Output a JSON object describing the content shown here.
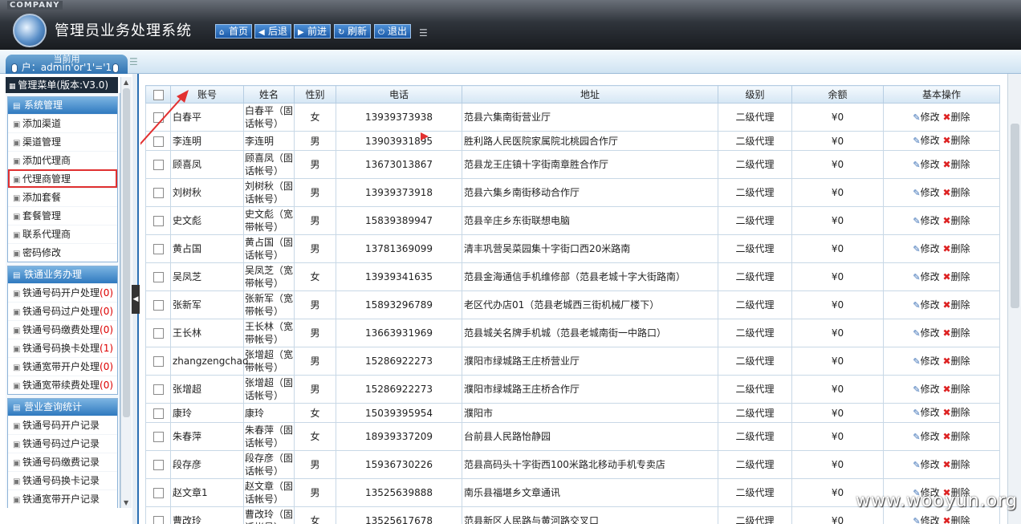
{
  "header": {
    "company": "COMPANY",
    "title": "管理员业务处理系统",
    "nav": [
      {
        "label": "首页",
        "icon": "home-icon"
      },
      {
        "label": "后退",
        "icon": "back-arrow-icon"
      },
      {
        "label": "前进",
        "icon": "forward-arrow-icon"
      },
      {
        "label": "刷新",
        "icon": "refresh-icon"
      },
      {
        "label": "退出",
        "icon": "power-icon"
      }
    ]
  },
  "user_tab": {
    "line1": "当前用",
    "line2": "户：admin'or'1'='1"
  },
  "sidebar": {
    "menu_title": "管理菜单(版本:V3.0)",
    "groups": [
      {
        "title": "系统管理",
        "items": [
          {
            "label": "添加渠道"
          },
          {
            "label": "渠道管理"
          },
          {
            "label": "添加代理商"
          },
          {
            "label": "代理商管理"
          },
          {
            "label": "添加套餐"
          },
          {
            "label": "套餐管理"
          },
          {
            "label": "联系代理商"
          },
          {
            "label": "密码修改"
          }
        ]
      },
      {
        "title": "铁通业务办理",
        "items": [
          {
            "label": "铁通号码开户处理",
            "count": "(0)"
          },
          {
            "label": "铁通号码过户处理",
            "count": "(0)"
          },
          {
            "label": "铁通号码缴费处理",
            "count": "(0)"
          },
          {
            "label": "铁通号码换卡处理",
            "count": "(1)"
          },
          {
            "label": "铁通宽带开户处理",
            "count": "(0)"
          },
          {
            "label": "铁通宽带续费处理",
            "count": "(0)"
          }
        ]
      },
      {
        "title": "营业查询统计",
        "items": [
          {
            "label": "铁通号码开户记录"
          },
          {
            "label": "铁通号码过户记录"
          },
          {
            "label": "铁通号码缴费记录"
          },
          {
            "label": "铁通号码换卡记录"
          },
          {
            "label": "铁通宽带开户记录"
          }
        ]
      }
    ]
  },
  "table": {
    "headers": [
      "账号",
      "姓名",
      "性别",
      "电话",
      "地址",
      "级别",
      "余额",
      "基本操作"
    ],
    "edit_label": "修改",
    "delete_label": "删除",
    "rows": [
      {
        "account": "白春平",
        "name": "白春平（固话帐号）",
        "gender": "女",
        "phone": "13939373938",
        "address": "范县六集南街营业厅",
        "level": "二级代理",
        "balance": "¥0"
      },
      {
        "account": "李连明",
        "name": "李连明",
        "gender": "男",
        "phone": "13903931895",
        "address": "胜利路人民医院家属院北桃园合作厅",
        "level": "二级代理",
        "balance": "¥0"
      },
      {
        "account": "顾喜凤",
        "name": "顾喜凤（固话帐号）",
        "gender": "男",
        "phone": "13673013867",
        "address": "范县龙王庄镇十字街南章胜合作厅",
        "level": "二级代理",
        "balance": "¥0"
      },
      {
        "account": "刘树秋",
        "name": "刘树秋（固话帐号）",
        "gender": "男",
        "phone": "13939373918",
        "address": "范县六集乡南街移动合作厅",
        "level": "二级代理",
        "balance": "¥0"
      },
      {
        "account": "史文彪",
        "name": "史文彪（宽带帐号）",
        "gender": "男",
        "phone": "15839389947",
        "address": "范县辛庄乡东街联想电脑",
        "level": "二级代理",
        "balance": "¥0"
      },
      {
        "account": "黄占国",
        "name": "黄占国（固话帐号）",
        "gender": "男",
        "phone": "13781369099",
        "address": "清丰巩营吴菜园集十字街口西20米路南",
        "level": "二级代理",
        "balance": "¥0"
      },
      {
        "account": "吴凤芝",
        "name": "吴凤芝（宽带帐号）",
        "gender": "女",
        "phone": "13939341635",
        "address": "范县金海通信手机维修部（范县老城十字大街路南）",
        "level": "二级代理",
        "balance": "¥0"
      },
      {
        "account": "张新军",
        "name": "张新军（宽带帐号）",
        "gender": "男",
        "phone": "15893296789",
        "address": "老区代办店01（范县老城西三街机械厂楼下）",
        "level": "二级代理",
        "balance": "¥0"
      },
      {
        "account": "王长林",
        "name": "王长林（宽带帐号）",
        "gender": "男",
        "phone": "13663931969",
        "address": "范县城关名牌手机城（范县老城南街一中路口）",
        "level": "二级代理",
        "balance": "¥0"
      },
      {
        "account": "zhangzengchao",
        "name": "张增超（宽带帐号）",
        "gender": "男",
        "phone": "15286922273",
        "address": "濮阳市绿城路王庄桥营业厅",
        "level": "二级代理",
        "balance": "¥0"
      },
      {
        "account": "张增超",
        "name": "张增超（固话帐号）",
        "gender": "男",
        "phone": "15286922273",
        "address": "濮阳市绿城路王庄桥合作厅",
        "level": "二级代理",
        "balance": "¥0"
      },
      {
        "account": "康玲",
        "name": "康玲",
        "gender": "女",
        "phone": "15039395954",
        "address": "濮阳市",
        "level": "二级代理",
        "balance": "¥0"
      },
      {
        "account": "朱春萍",
        "name": "朱春萍（固话帐号）",
        "gender": "女",
        "phone": "18939337209",
        "address": "台前县人民路怡静园",
        "level": "二级代理",
        "balance": "¥0"
      },
      {
        "account": "段存彦",
        "name": "段存彦（固话帐号）",
        "gender": "男",
        "phone": "15936730226",
        "address": "范县高码头十字街西100米路北移动手机专卖店",
        "level": "二级代理",
        "balance": "¥0"
      },
      {
        "account": "赵文章1",
        "name": "赵文章（固话帐号）",
        "gender": "男",
        "phone": "13525639888",
        "address": "南乐县福堪乡文章通讯",
        "level": "二级代理",
        "balance": "¥0"
      },
      {
        "account": "曹改玲",
        "name": "曹改玲（固话帐号）",
        "gender": "女",
        "phone": "13525617678",
        "address": "范县新区人民路与黄河路交叉口",
        "level": "二级代理",
        "balance": "¥0"
      }
    ]
  },
  "watermark": "www.wooyun.org",
  "colors": {
    "accent": "#2f79bf",
    "highlight_box": "#e03030",
    "count_red": "#dd0000"
  }
}
